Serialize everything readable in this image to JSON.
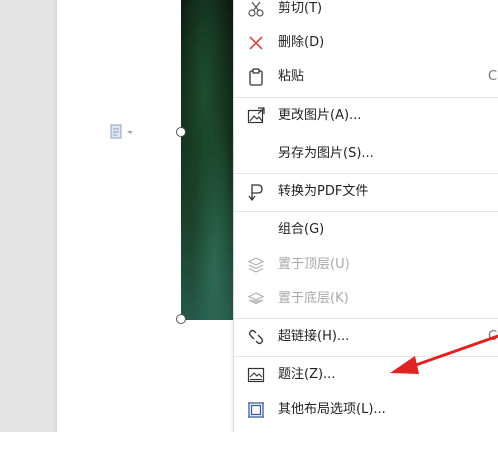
{
  "menu": {
    "items": [
      {
        "name": "cut",
        "label": "剪切(T)",
        "icon": "scissors-icon",
        "disabled": false,
        "shortcut": ""
      },
      {
        "name": "delete",
        "label": "删除(D)",
        "icon": "x-icon",
        "disabled": false,
        "shortcut": ""
      },
      {
        "name": "paste",
        "label": "粘贴",
        "icon": "clipboard-icon",
        "disabled": false,
        "shortcut": "C"
      },
      {
        "name": "change-picture",
        "label": "更改图片(A)...",
        "icon": "change-image-icon",
        "disabled": false,
        "shortcut": ""
      },
      {
        "name": "save-as-picture",
        "label": "另存为图片(S)...",
        "icon": "",
        "disabled": false,
        "shortcut": ""
      },
      {
        "name": "convert-pdf",
        "label": "转换为PDF文件",
        "icon": "pdf-convert-icon",
        "disabled": false,
        "shortcut": ""
      },
      {
        "name": "group",
        "label": "组合(G)",
        "icon": "",
        "disabled": false,
        "shortcut": ""
      },
      {
        "name": "bring-to-top",
        "label": "置于顶层(U)",
        "icon": "bring-front-icon",
        "disabled": true,
        "shortcut": ""
      },
      {
        "name": "send-to-bottom",
        "label": "置于底层(K)",
        "icon": "send-back-icon",
        "disabled": true,
        "shortcut": ""
      },
      {
        "name": "hyperlink",
        "label": "超链接(H)...",
        "icon": "link-icon",
        "disabled": false,
        "shortcut": "C"
      },
      {
        "name": "caption",
        "label": "题注(Z)...",
        "icon": "caption-icon",
        "disabled": false,
        "shortcut": ""
      },
      {
        "name": "layout-options",
        "label": "其他布局选项(L)...",
        "icon": "layout-icon",
        "disabled": false,
        "shortcut": ""
      }
    ]
  },
  "colors": {
    "delete_icon": "#e04343",
    "arrow": "#e02424",
    "disabled_text": "#a8a8a8"
  }
}
